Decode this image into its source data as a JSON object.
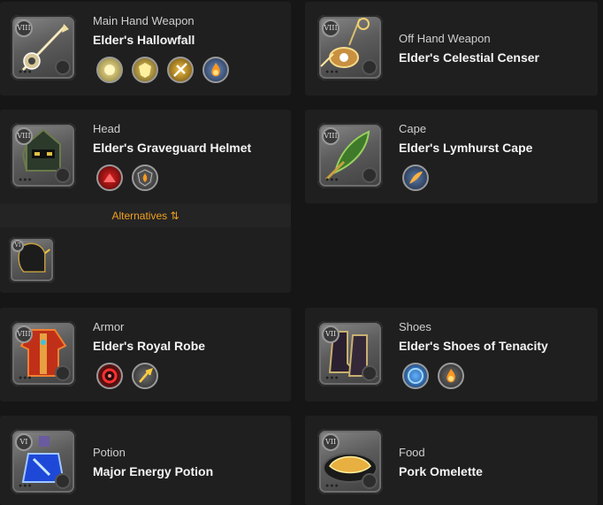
{
  "colors": {
    "accent": "#f0a020",
    "card": "#1f1f1f",
    "background": "#161616"
  },
  "slots": {
    "main_hand": {
      "slot": "Main Hand Weapon",
      "name": "Elder's Hallowfall",
      "tier": "VIII",
      "spells": [
        "gold-orb-spell-icon",
        "gold-shield-spell-icon",
        "golden-strike-spell-icon",
        "flame-passive-icon"
      ]
    },
    "off_hand": {
      "slot": "Off Hand Weapon",
      "name": "Elder's Celestial Censer",
      "tier": "VIII",
      "spells": []
    },
    "head": {
      "slot": "Head",
      "name": "Elder's Graveguard Helmet",
      "tier": "VIII",
      "spells": [
        "red-burst-spell-icon",
        "flame-shield-passive-icon"
      ]
    },
    "cape": {
      "slot": "Cape",
      "name": "Elder's Lymhurst Cape",
      "tier": "VIII",
      "spells": [
        "wind-slash-passive-icon"
      ]
    },
    "armor": {
      "slot": "Armor",
      "name": "Elder's Royal Robe",
      "tier": "VIII",
      "spells": [
        "crimson-ring-spell-icon",
        "lightning-passive-icon"
      ]
    },
    "shoes": {
      "slot": "Shoes",
      "name": "Elder's Shoes of Tenacity",
      "tier": "VII",
      "spells": [
        "blue-dash-spell-icon",
        "flame-passive-icon"
      ]
    },
    "potion": {
      "slot": "Potion",
      "name": "Major Energy Potion",
      "tier": "VI"
    },
    "food": {
      "slot": "Food",
      "name": "Pork Omelette",
      "tier": "VII"
    }
  },
  "alternatives": {
    "label": "Alternatives",
    "glyph": "⇅",
    "items": [
      "hood-alternative-icon"
    ]
  }
}
